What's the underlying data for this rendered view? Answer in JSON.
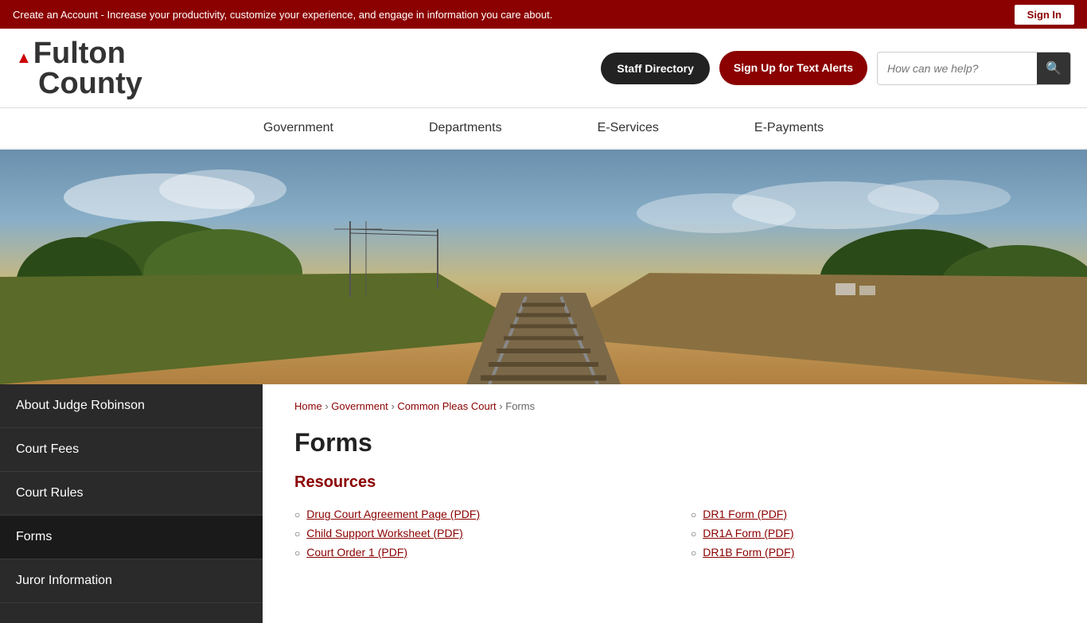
{
  "top_banner": {
    "text": "Create an Account - Increase your productivity, customize your experience, and engage in information you care about.",
    "sign_in_label": "Sign In"
  },
  "header": {
    "logo_line1": "Fulton",
    "logo_line2": "County",
    "staff_directory_label": "Staff Directory",
    "text_alerts_label": "Sign Up for Text Alerts",
    "search_placeholder": "How can we help?"
  },
  "main_nav": {
    "items": [
      {
        "label": "Government",
        "id": "government"
      },
      {
        "label": "Departments",
        "id": "departments"
      },
      {
        "label": "E-Services",
        "id": "eservices"
      },
      {
        "label": "E-Payments",
        "id": "epayments"
      }
    ]
  },
  "sidebar": {
    "items": [
      {
        "label": "About Judge Robinson",
        "id": "about-judge",
        "active": false
      },
      {
        "label": "Court Fees",
        "id": "court-fees",
        "active": false
      },
      {
        "label": "Court Rules",
        "id": "court-rules",
        "active": false
      },
      {
        "label": "Forms",
        "id": "forms",
        "active": true
      },
      {
        "label": "Juror Information",
        "id": "juror-info",
        "active": false
      }
    ]
  },
  "breadcrumb": {
    "items": [
      {
        "label": "Home",
        "href": "#"
      },
      {
        "label": "Government",
        "href": "#"
      },
      {
        "label": "Common Pleas Court",
        "href": "#"
      },
      {
        "label": "Forms",
        "href": null
      }
    ]
  },
  "page": {
    "title": "Forms",
    "resources_section_title": "Resources",
    "left_links": [
      {
        "label": "Drug Court Agreement Page (PDF)",
        "href": "#"
      },
      {
        "label": "Child Support Worksheet (PDF)",
        "href": "#"
      },
      {
        "label": "Court Order 1 (PDF)",
        "href": "#"
      }
    ],
    "right_links": [
      {
        "label": "DR1 Form (PDF)",
        "href": "#"
      },
      {
        "label": "DR1A Form (PDF)",
        "href": "#"
      },
      {
        "label": "DR1B Form (PDF)",
        "href": "#"
      }
    ]
  },
  "icons": {
    "search": "🔍",
    "arrow_up": "▲"
  }
}
